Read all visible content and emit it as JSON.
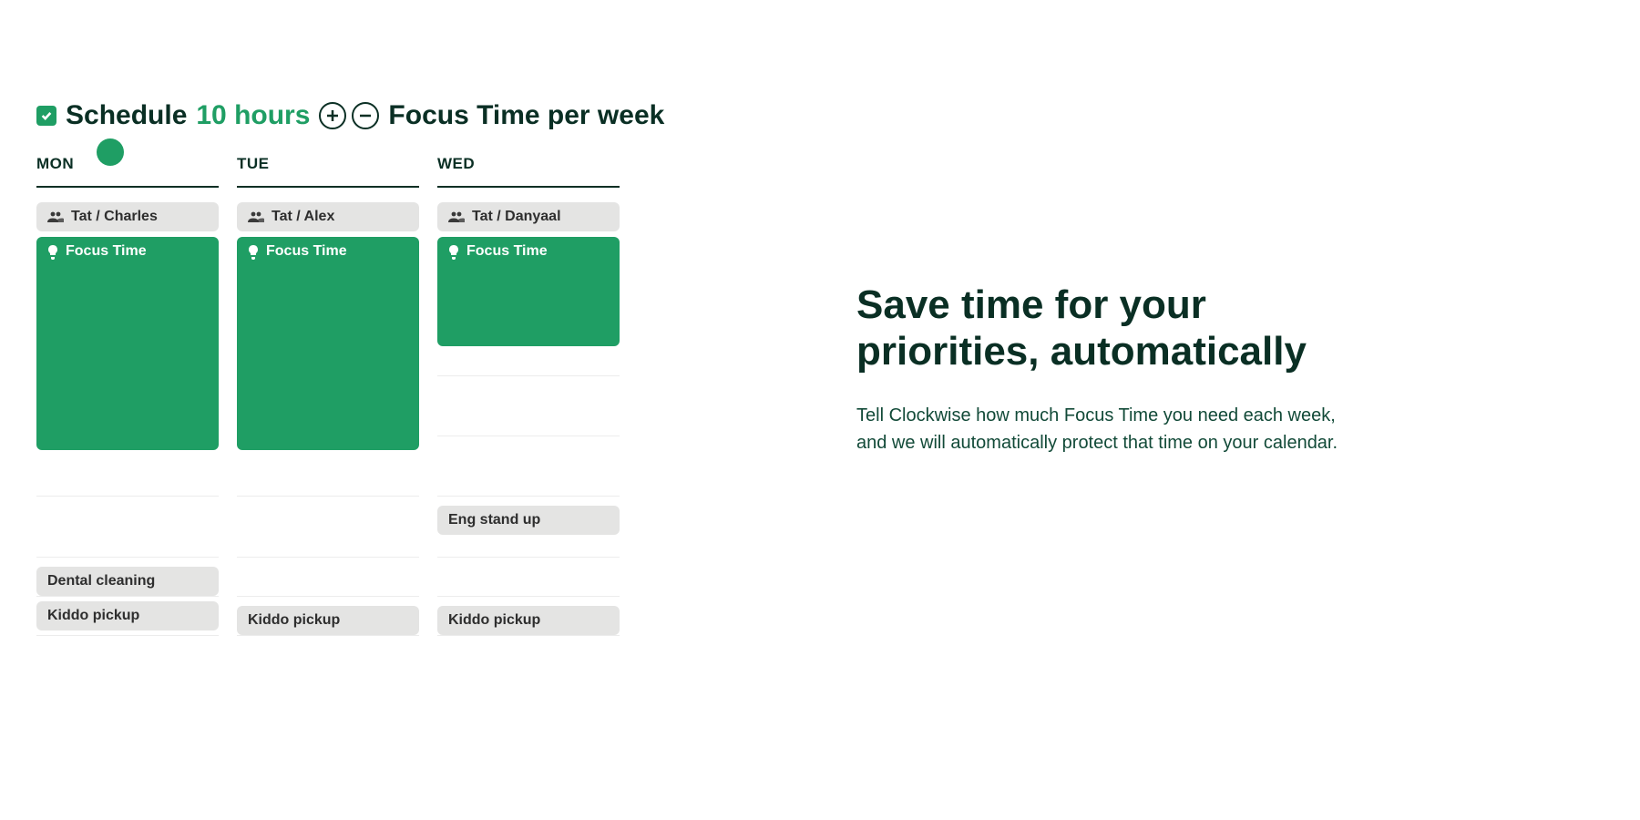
{
  "toggle": {
    "checked": true,
    "prefix": "Schedule",
    "hours": "10 hours",
    "suffix": "Focus Time per week"
  },
  "days": {
    "mon": {
      "label": "MON",
      "meeting": "Tat / Charles",
      "focus": "Focus Time",
      "extra1": "Dental cleaning",
      "pickup": "Kiddo pickup"
    },
    "tue": {
      "label": "TUE",
      "meeting": "Tat / Alex",
      "focus": "Focus Time",
      "pickup": "Kiddo pickup"
    },
    "wed": {
      "label": "WED",
      "meeting": "Tat / Danyaal",
      "focus": "Focus Time",
      "standup": "Eng stand up",
      "pickup": "Kiddo pickup"
    }
  },
  "copy": {
    "heading": "Save time for your priorities, automatically",
    "body": "Tell Clockwise how much Focus Time you need each week, and we will automatically protect that time on your calendar."
  },
  "colors": {
    "green": "#1f9e64",
    "dark": "#0a2f24",
    "gray": "#e4e4e3"
  }
}
